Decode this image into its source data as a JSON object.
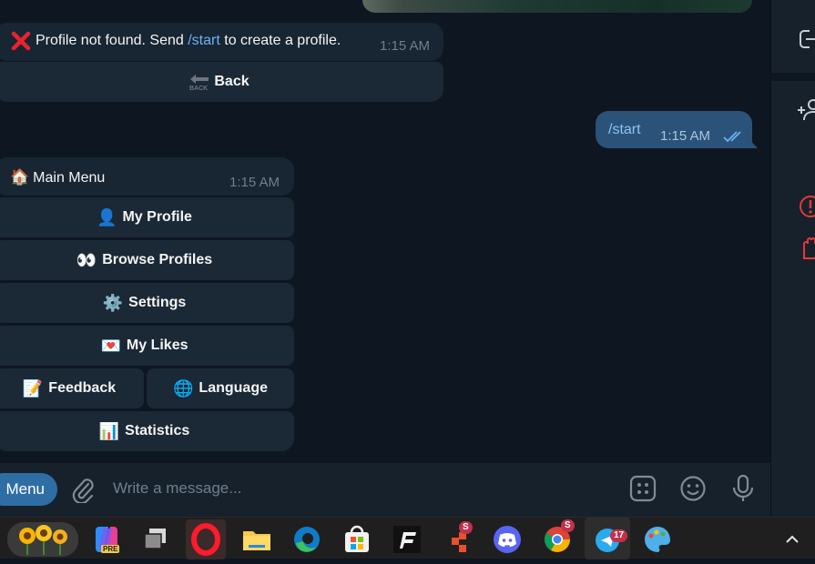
{
  "chat": {
    "error_message": {
      "icon": "cross-mark-icon",
      "text_before": "Profile not found. Send ",
      "link": "/start",
      "text_after": " to create a profile.",
      "time": "1:15 AM"
    },
    "back_button": {
      "icon": "back-arrow-icon",
      "label": "Back"
    },
    "outgoing_message": {
      "text": "/start",
      "time": "1:15 AM",
      "status_icon": "double-check-icon"
    },
    "main_menu_message": {
      "emoji": "🏠",
      "text": "Main Menu",
      "time": "1:15 AM"
    },
    "keyboard": {
      "my_profile": {
        "emoji": "👤",
        "label": "My Profile"
      },
      "browse_profiles": {
        "emoji": "👀",
        "label": "Browse Profiles"
      },
      "settings": {
        "emoji": "⚙️",
        "label": "Settings"
      },
      "my_likes": {
        "emoji": "💌",
        "label": "My Likes"
      },
      "feedback": {
        "emoji": "📝",
        "label": "Feedback"
      },
      "language": {
        "emoji": "🌐",
        "label": "Language"
      },
      "statistics": {
        "emoji": "📊",
        "label": "Statistics"
      }
    }
  },
  "input_bar": {
    "menu_label": "Menu",
    "placeholder": "Write a message...",
    "icons": [
      "paperclip-icon",
      "bot-commands-icon",
      "emoji-icon",
      "microphone-icon"
    ]
  },
  "right_panel": {
    "icons": [
      "leave-icon",
      "add-user-icon",
      "report-icon",
      "block-icon"
    ]
  },
  "taskbar": {
    "apps": [
      "sunflower-widget",
      "copilot-pre",
      "task-view",
      "opera",
      "file-explorer",
      "edge",
      "microsoft-store",
      "app-f",
      "app-orange",
      "discord",
      "chrome",
      "telegram",
      "paint"
    ],
    "telegram_badge": "17",
    "badge_s": "S",
    "copilot_badge": "PRE"
  },
  "colors": {
    "chat_bg": "#0e1621",
    "panel_bg": "#17212b",
    "bubble": "#182533",
    "outgoing": "#2b5278",
    "link": "#6ab3f3",
    "accent": "#2f6ea5"
  }
}
